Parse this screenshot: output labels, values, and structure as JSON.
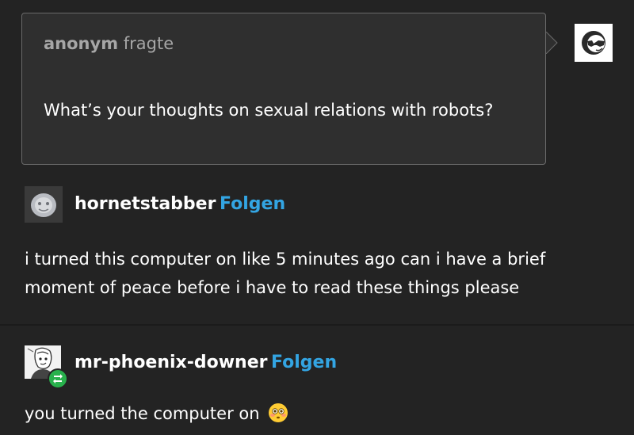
{
  "ask": {
    "asker": "anonym",
    "verb": "fragte",
    "question": "What’s your thoughts on sexual relations with robots?"
  },
  "posts": [
    {
      "username": "hornetstabber",
      "follow_label": "Folgen",
      "text": "i turned this computer on like 5 minutes ago can i have a brief moment of peace before i have to read these things please"
    },
    {
      "username": "mr-phoenix-downer",
      "follow_label": "Folgen",
      "text": "you turned the computer on",
      "emoji": "flushed-face-emoji"
    }
  ],
  "colors": {
    "background": "#232323",
    "ask_box": "#2f2f2f",
    "follow_link": "#33a5e3",
    "reblog_badge": "#28b14c",
    "muted_text": "#a6a6a6"
  }
}
